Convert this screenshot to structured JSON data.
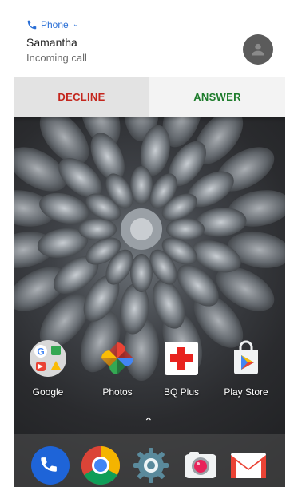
{
  "notification": {
    "app_name": "Phone",
    "caller_name": "Samantha",
    "status": "Incoming call",
    "decline_label": "DECLINE",
    "answer_label": "ANSWER"
  },
  "home_apps": [
    {
      "label": "Google",
      "icon": "google-folder-icon"
    },
    {
      "label": "Photos",
      "icon": "photos-icon"
    },
    {
      "label": "BQ Plus",
      "icon": "bq-plus-icon"
    },
    {
      "label": "Play Store",
      "icon": "play-store-icon"
    }
  ],
  "dock": [
    {
      "icon": "phone-icon"
    },
    {
      "icon": "chrome-icon"
    },
    {
      "icon": "settings-icon"
    },
    {
      "icon": "camera-icon"
    },
    {
      "icon": "gmail-icon"
    }
  ],
  "colors": {
    "accent": "#2a6fd6",
    "decline": "#c4261d",
    "answer": "#1e7c2c"
  }
}
